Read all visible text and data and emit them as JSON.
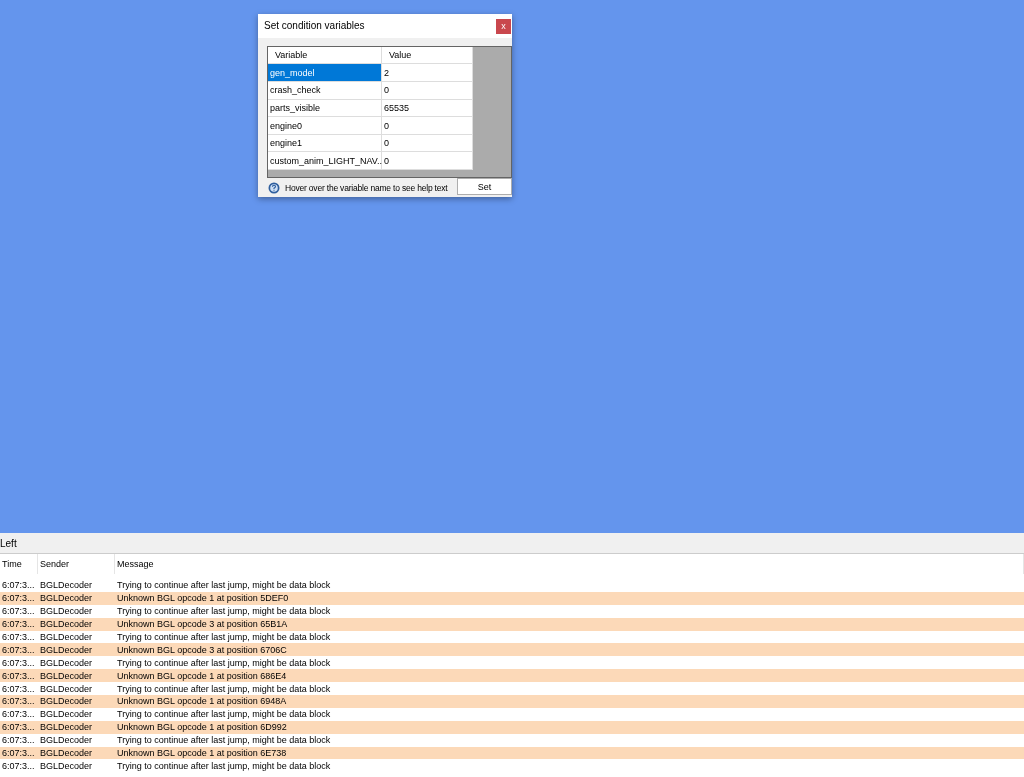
{
  "dialog": {
    "title": "Set condition variables",
    "close": "x",
    "columns": [
      "Variable",
      "Value"
    ],
    "rows": [
      {
        "variable": "gen_model",
        "value": "2",
        "selected": true
      },
      {
        "variable": "crash_check",
        "value": "0",
        "selected": false
      },
      {
        "variable": "parts_visible",
        "value": "65535",
        "selected": false
      },
      {
        "variable": "engine0",
        "value": "0",
        "selected": false
      },
      {
        "variable": "engine1",
        "value": "0",
        "selected": false
      },
      {
        "variable": "custom_anim_LIGHT_NAV...",
        "value": "0",
        "selected": false
      }
    ],
    "help_text": "Hover over the variable name to see help text",
    "set_button": "Set"
  },
  "log_panel": {
    "title": "Left",
    "columns": [
      "Time",
      "Sender",
      "Message"
    ],
    "rows": [
      {
        "time": "6:07:3...",
        "sender": "BGLDecoder",
        "message": "Trying to continue after last jump, might be data block",
        "highlighted": false
      },
      {
        "time": "6:07:3...",
        "sender": "BGLDecoder",
        "message": "Unknown BGL opcode 1 at position 5DEF0",
        "highlighted": true
      },
      {
        "time": "6:07:3...",
        "sender": "BGLDecoder",
        "message": "Trying to continue after last jump, might be data block",
        "highlighted": false
      },
      {
        "time": "6:07:3...",
        "sender": "BGLDecoder",
        "message": "Unknown BGL opcode 3 at position 65B1A",
        "highlighted": true
      },
      {
        "time": "6:07:3...",
        "sender": "BGLDecoder",
        "message": "Trying to continue after last jump, might be data block",
        "highlighted": false
      },
      {
        "time": "6:07:3...",
        "sender": "BGLDecoder",
        "message": "Unknown BGL opcode 3 at position 6706C",
        "highlighted": true
      },
      {
        "time": "6:07:3...",
        "sender": "BGLDecoder",
        "message": "Trying to continue after last jump, might be data block",
        "highlighted": false
      },
      {
        "time": "6:07:3...",
        "sender": "BGLDecoder",
        "message": "Unknown BGL opcode 1 at position 686E4",
        "highlighted": true
      },
      {
        "time": "6:07:3...",
        "sender": "BGLDecoder",
        "message": "Trying to continue after last jump, might be data block",
        "highlighted": false
      },
      {
        "time": "6:07:3...",
        "sender": "BGLDecoder",
        "message": "Unknown BGL opcode 1 at position 6948A",
        "highlighted": true
      },
      {
        "time": "6:07:3...",
        "sender": "BGLDecoder",
        "message": "Trying to continue after last jump, might be data block",
        "highlighted": false
      },
      {
        "time": "6:07:3...",
        "sender": "BGLDecoder",
        "message": "Unknown BGL opcode 1 at position 6D992",
        "highlighted": true
      },
      {
        "time": "6:07:3...",
        "sender": "BGLDecoder",
        "message": "Trying to continue after last jump, might be data block",
        "highlighted": false
      },
      {
        "time": "6:07:3...",
        "sender": "BGLDecoder",
        "message": "Unknown BGL opcode 1 at position 6E738",
        "highlighted": true
      },
      {
        "time": "6:07:3...",
        "sender": "BGLDecoder",
        "message": "Trying to continue after last jump, might be data block",
        "highlighted": false
      }
    ]
  }
}
